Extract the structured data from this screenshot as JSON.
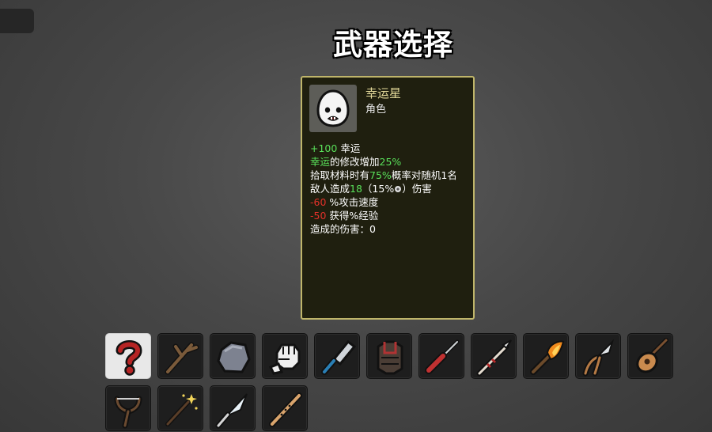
{
  "title": "武器选择",
  "character": {
    "name": "幸运星",
    "type": "角色",
    "portrait_icon": "egg-face-icon",
    "stats": [
      {
        "value": "+100",
        "text": " 幸运"
      },
      {
        "highlight": "幸运",
        "text": "的修改增加",
        "value": "25%"
      },
      {
        "pre": "拾取材料时有",
        "value": "75%",
        "post": "概率对随机1名"
      },
      {
        "pre": "敌人造成",
        "value": "18",
        "post": "（15%",
        "icon": "luck-icon",
        "post2": "）伤害"
      },
      {
        "value": "-60",
        "text": " %攻击速度"
      },
      {
        "value": "-50",
        "text": " 获得%经验"
      },
      {
        "text": "造成的伤害：0"
      }
    ]
  },
  "weapons": [
    {
      "icon": "random-question-icon",
      "selected": true
    },
    {
      "icon": "stick-icon"
    },
    {
      "icon": "rock-icon"
    },
    {
      "icon": "fist-icon"
    },
    {
      "icon": "cleaver-icon"
    },
    {
      "icon": "chest-plate-icon"
    },
    {
      "icon": "screwdriver-icon"
    },
    {
      "icon": "spear-icon"
    },
    {
      "icon": "torch-icon"
    },
    {
      "icon": "pruner-icon"
    },
    {
      "icon": "lute-icon"
    },
    {
      "icon": "slingshot-icon"
    },
    {
      "icon": "magic-wand-icon"
    },
    {
      "icon": "dagger-icon"
    },
    {
      "icon": "flute-icon"
    }
  ],
  "colors": {
    "positive": "#59e05a",
    "negative": "#e3312a",
    "card_border": "#bfb56a",
    "card_name": "#e3d99a"
  }
}
